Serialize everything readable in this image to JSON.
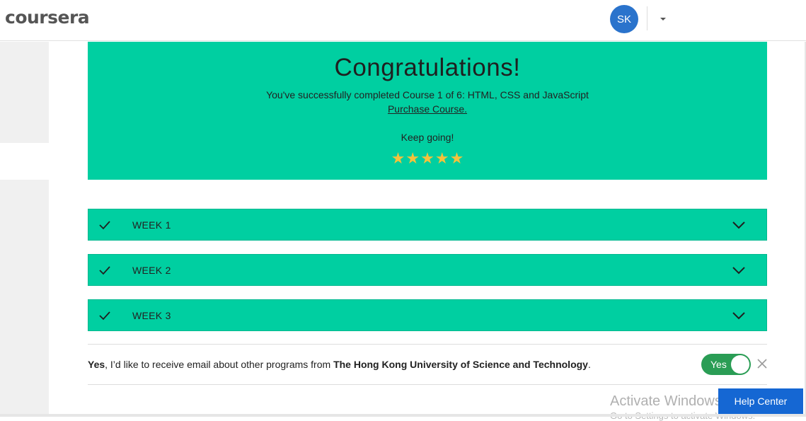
{
  "header": {
    "logo": "coursera",
    "avatar_initials": "SK"
  },
  "congrats": {
    "title": "Congratulations!",
    "subtitle": "You've successfully completed Course 1 of 6: HTML, CSS and JavaScript",
    "purchase_link": "Purchase Course.",
    "keep_going": "Keep going!",
    "rating_stars": 5,
    "star_color": "#f5c23b",
    "banner_color": "#00cfa1"
  },
  "weeks": [
    {
      "label": "WEEK 1",
      "completed": true
    },
    {
      "label": "WEEK 2",
      "completed": true
    },
    {
      "label": "WEEK 3",
      "completed": true
    }
  ],
  "email_opt_in": {
    "lead": "Yes",
    "text": ", I’d like to receive email about other programs from ",
    "org": "The Hong Kong University of Science and Technology",
    "trail": ".",
    "toggle_label": "Yes",
    "toggle_on": true
  },
  "watermark": {
    "line1": "Activate Windows",
    "line2": "Go to Settings to activate Windows."
  },
  "help_center": "Help Center"
}
